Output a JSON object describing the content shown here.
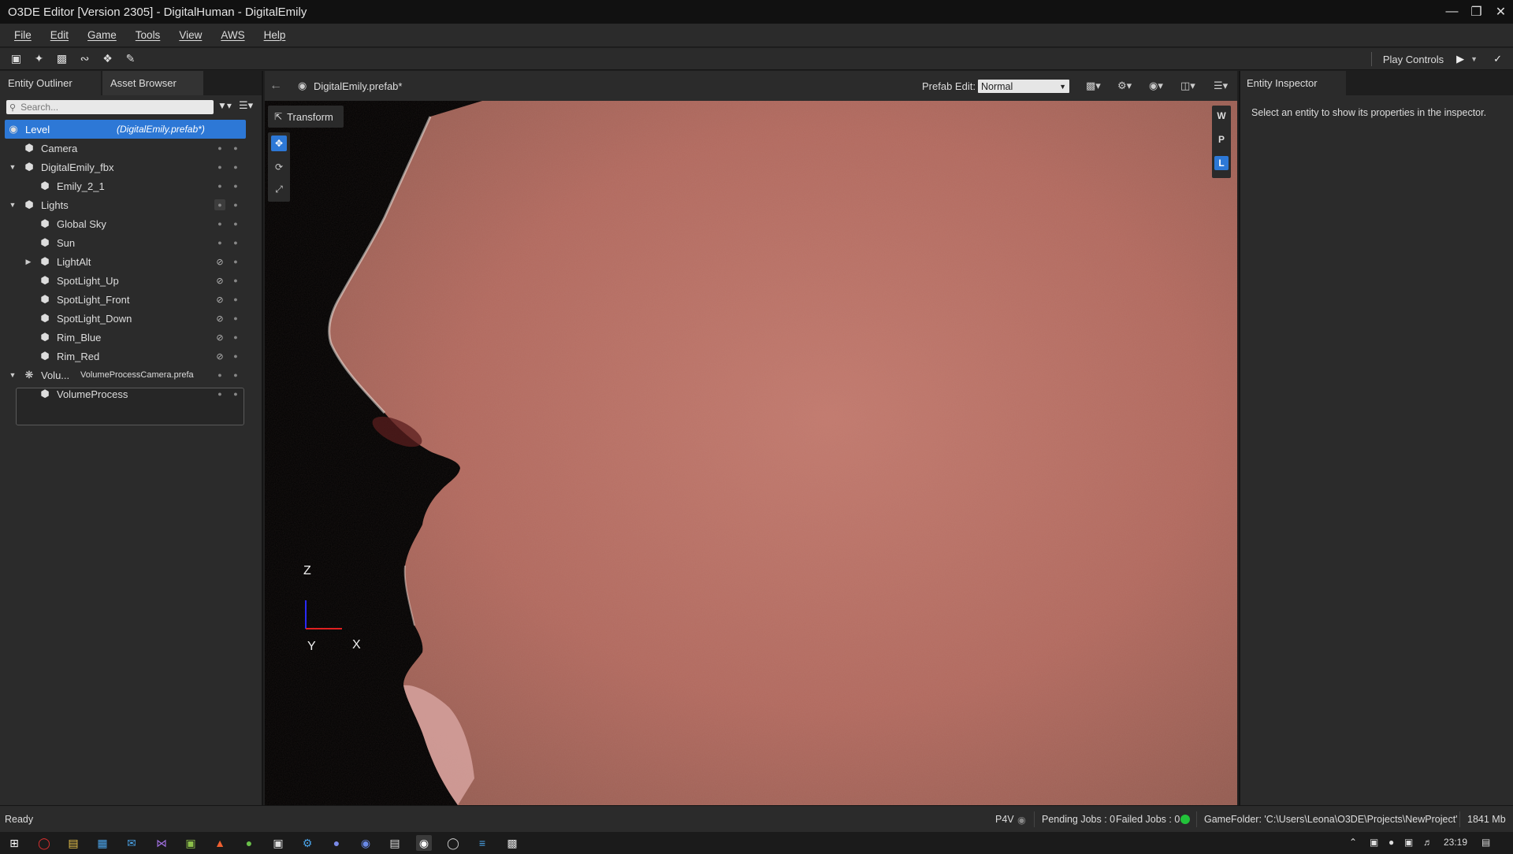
{
  "window": {
    "title": "O3DE Editor [Version 2305] - DigitalHuman - DigitalEmily",
    "controls": [
      "minimize-icon",
      "restore-icon",
      "close-icon"
    ]
  },
  "menu": [
    "File",
    "Edit",
    "Game",
    "Tools",
    "View",
    "AWS",
    "Help"
  ],
  "toolbar": {
    "icons": [
      "lock-icon",
      "figure-icon",
      "paint-icon",
      "path-icon",
      "wrench-icon",
      "brush-icon"
    ],
    "play_controls_label": "Play Controls"
  },
  "outliner": {
    "tabs": [
      "Entity Outliner",
      "Asset Browser"
    ],
    "search_placeholder": "Search...",
    "level": {
      "label": "Level",
      "prefab": "(DigitalEmily.prefab*)"
    },
    "rows": [
      {
        "label": "Camera"
      },
      {
        "label": "DigitalEmily_fbx"
      },
      {
        "label": "Emily_2_1"
      },
      {
        "label": "Lights"
      },
      {
        "label": "Global Sky"
      },
      {
        "label": "Sun"
      },
      {
        "label": "LightAlt"
      },
      {
        "label": "SpotLight_Up"
      },
      {
        "label": "SpotLight_Front"
      },
      {
        "label": "SpotLight_Down"
      },
      {
        "label": "Rim_Blue"
      },
      {
        "label": "Rim_Red"
      },
      {
        "label": "Volu...",
        "sub": "VolumeProcessCamera.prefa"
      },
      {
        "label": "VolumeProcess"
      }
    ]
  },
  "viewport": {
    "prefab_name": "DigitalEmily.prefab*",
    "prefab_edit_label": "Prefab Edit:",
    "prefab_edit_value": "Normal",
    "transform_label": "Transform",
    "space_buttons": [
      "W",
      "P",
      "L"
    ],
    "active_space": "L",
    "axes": {
      "z": "Z",
      "y": "Y",
      "x": "X"
    }
  },
  "inspector": {
    "tab": "Entity Inspector",
    "message": "Select an entity to show its properties in the inspector."
  },
  "status": {
    "state": "Ready",
    "p4v": "P4V",
    "pending_jobs": "Pending Jobs : 0",
    "failed_jobs": "Failed Jobs : 0",
    "game_folder": "GameFolder: 'C:\\Users\\Leona\\O3DE\\Projects\\NewProject'",
    "memory": "1841 Mb"
  },
  "taskbar": {
    "time": "23:19"
  },
  "colors": {
    "accent": "#2d78d6",
    "panel": "#2b2b2b",
    "status_ok": "#22c23a"
  }
}
